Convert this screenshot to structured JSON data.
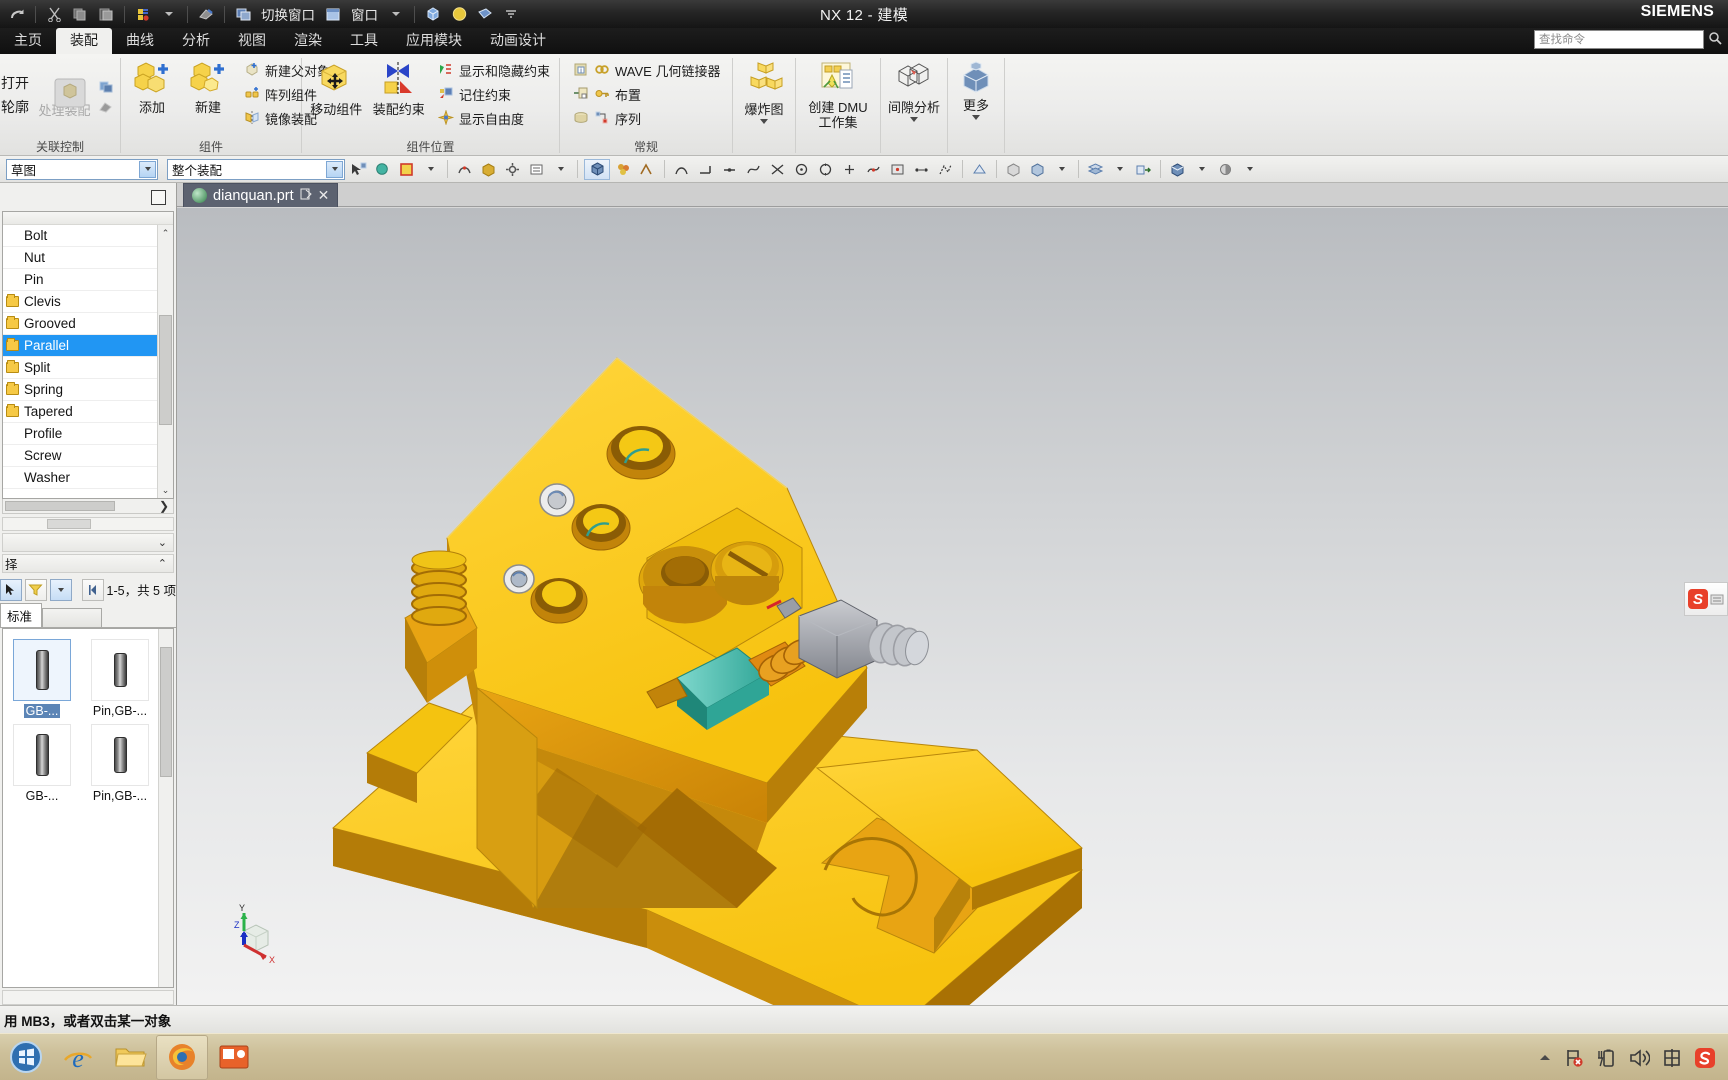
{
  "titlebar": {
    "app_title": "NX 12 - 建模",
    "brand": "SIEMENS",
    "quick_access": [
      {
        "name": "redo-icon",
        "glyph": "↷"
      },
      {
        "name": "cut-icon",
        "glyph": "✂"
      },
      {
        "name": "copy-icon",
        "glyph": "❏"
      },
      {
        "name": "paste-icon",
        "glyph": "❐"
      },
      {
        "name": "undo-history-icon",
        "glyph": "▣"
      },
      {
        "name": "eraser-icon",
        "glyph": "◆"
      }
    ],
    "switch_window_label": "切换窗口",
    "window_label": "窗口"
  },
  "ribbon": {
    "tabs": [
      {
        "label": "主页",
        "active": false
      },
      {
        "label": "装配",
        "active": true
      },
      {
        "label": "曲线",
        "active": false
      },
      {
        "label": "分析",
        "active": false
      },
      {
        "label": "视图",
        "active": false
      },
      {
        "label": "渲染",
        "active": false
      },
      {
        "label": "工具",
        "active": false
      },
      {
        "label": "应用模块",
        "active": false
      },
      {
        "label": "动画设计",
        "active": false
      }
    ],
    "find_placeholder": "查找命令",
    "groups": [
      {
        "name": "关联控制",
        "label": "关联控制",
        "truncated_items": [
          "打开",
          "轮廓"
        ],
        "big": {
          "label": "处理装配",
          "disabled": true
        }
      },
      {
        "name": "组件",
        "label": "组件",
        "big_buttons": [
          {
            "label": "添加"
          },
          {
            "label": "新建"
          }
        ],
        "small_buttons": [
          {
            "label": "新建父对象"
          },
          {
            "label": "阵列组件"
          },
          {
            "label": "镜像装配"
          }
        ]
      },
      {
        "name": "组件位置",
        "label": "组件位置",
        "big_buttons": [
          {
            "label": "移动组件"
          },
          {
            "label": "装配约束"
          }
        ],
        "small_buttons": [
          {
            "label": "显示和隐藏约束"
          },
          {
            "label": "记住约束"
          },
          {
            "label": "显示自由度"
          }
        ]
      },
      {
        "name": "常规",
        "label": "常规",
        "small_buttons": [
          {
            "label": "WAVE 几何链接器"
          },
          {
            "label": "布置"
          },
          {
            "label": "序列"
          }
        ]
      },
      {
        "name": "爆炸图组",
        "label": "",
        "big_buttons": [
          {
            "label": "爆炸图",
            "has_caret": true
          }
        ]
      },
      {
        "name": "DMU组",
        "label": "",
        "big_buttons": [
          {
            "label": "创建 DMU 工作集"
          }
        ]
      },
      {
        "name": "间隙分析组",
        "label": "",
        "big_buttons": [
          {
            "label": "间隙分析",
            "has_caret": true
          }
        ]
      },
      {
        "name": "更多组",
        "label": "",
        "big_buttons": [
          {
            "label": "更多",
            "has_caret": true
          }
        ]
      }
    ]
  },
  "selection_bar": {
    "type_filter_value": "草图",
    "scope_value": "整个装配",
    "icons": [
      "snap-point-icon",
      "snap-sphere-icon",
      "selection-filter-icon",
      "curve-rule-icon",
      "chain-icon",
      "stop-at-intersection-icon",
      "snap-settings-icon",
      "face-rule-icon",
      "shaded-display-icon",
      "face-color-icon",
      "point-icon",
      "endpoint-icon",
      "midpoint-icon",
      "control-point-icon",
      "intersection-icon",
      "arc-center-icon",
      "quadrant-icon",
      "existing-point-icon",
      "point-on-curve-icon",
      "point-on-face-icon",
      "between-points-icon",
      "spline-pole-icon",
      "boundary-icon",
      "utility-icon",
      "layer-icon",
      "view-icon",
      "shading-icon",
      "style-icon"
    ]
  },
  "left_panel": {
    "tree_items": [
      {
        "label": "Bolt",
        "type": "item",
        "selected": false
      },
      {
        "label": "Nut",
        "type": "item",
        "selected": false
      },
      {
        "label": "Pin",
        "type": "item",
        "selected": false
      },
      {
        "label": "Clevis",
        "type": "folder",
        "selected": false
      },
      {
        "label": "Grooved",
        "type": "folder",
        "selected": false
      },
      {
        "label": "Parallel",
        "type": "folder",
        "selected": true
      },
      {
        "label": "Split",
        "type": "folder",
        "selected": false
      },
      {
        "label": "Spring",
        "type": "folder",
        "selected": false
      },
      {
        "label": "Tapered",
        "type": "folder",
        "selected": false
      },
      {
        "label": "Profile",
        "type": "item",
        "selected": false
      },
      {
        "label": "Screw",
        "type": "item",
        "selected": false
      },
      {
        "label": "Washer",
        "type": "item",
        "selected": false
      }
    ],
    "section_label_1": "",
    "section_label_2": "择",
    "paging_text": "1-5，共 5 项",
    "tab_label": "标准",
    "members": [
      {
        "label": "GB-...",
        "selected": true,
        "icon": "pin-thumbnail"
      },
      {
        "label": "Pin,GB-...",
        "selected": false,
        "icon": "pin-thumbnail"
      },
      {
        "label": "GB-...",
        "selected": false,
        "icon": "pin-thumbnail"
      },
      {
        "label": "Pin,GB-...",
        "selected": false,
        "icon": "pin-thumbnail"
      }
    ]
  },
  "graphics": {
    "file_tab": "dianquan.prt",
    "triad_labels": {
      "x": "X",
      "y": "Y",
      "z": "Z"
    },
    "watermark": "S"
  },
  "status_bar": {
    "message": "用 MB3，或者双击某一对象"
  },
  "taskbar": {
    "items": [
      {
        "name": "start-orb",
        "glyph": "⊞"
      },
      {
        "name": "ie-browser-icon",
        "glyph": "e"
      },
      {
        "name": "file-explorer-icon",
        "glyph": "📁"
      },
      {
        "name": "firefox-icon",
        "glyph": "◉"
      },
      {
        "name": "media-app-icon",
        "glyph": "▣"
      }
    ],
    "tray": [
      {
        "name": "show-hidden-icons-icon",
        "glyph": "▲"
      },
      {
        "name": "network-error-icon",
        "glyph": "⚑"
      },
      {
        "name": "battery-icon",
        "glyph": "▮"
      },
      {
        "name": "volume-icon",
        "glyph": "🔊"
      },
      {
        "name": "ime-chinese-icon",
        "glyph": "中"
      },
      {
        "name": "sogou-input-icon",
        "glyph": "S"
      }
    ]
  },
  "colors": {
    "accent_blue": "#2196f3",
    "part_yellow": "#f5c518",
    "titlebar_dark": "#1a1a1a",
    "ribbon_bg": "#efefed",
    "taskbar": "#cdc09a"
  }
}
